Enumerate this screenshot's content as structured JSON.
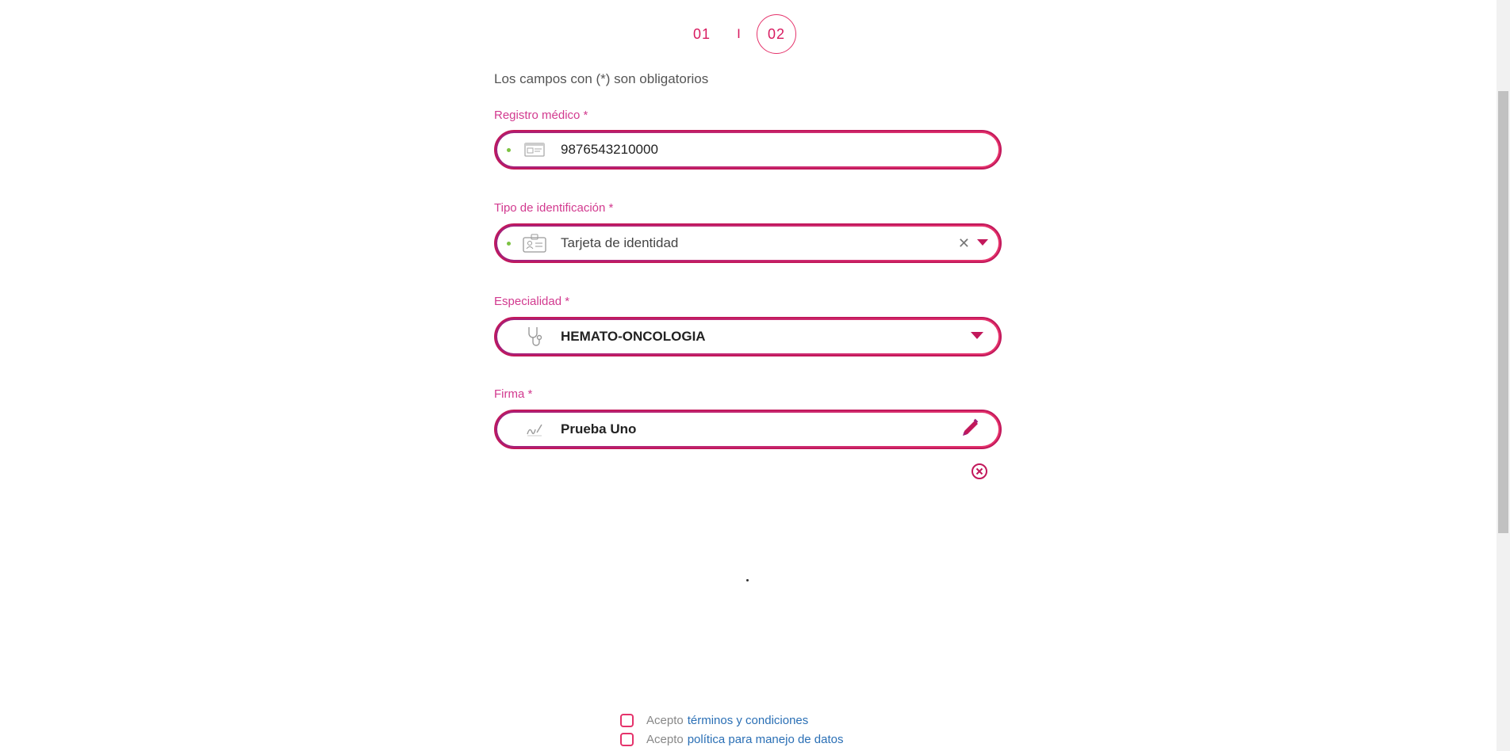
{
  "stepper": {
    "step1": "01",
    "separator": "I",
    "step2": "02"
  },
  "form": {
    "required_note": "Los campos con (*) son obligatorios",
    "registro": {
      "label": "Registro médico *",
      "value": "9876543210000",
      "icon": "id-card-icon"
    },
    "tipo_id": {
      "label": "Tipo de identificación *",
      "value": "Tarjeta de identidad",
      "icon": "badge-icon"
    },
    "especialidad": {
      "label": "Especialidad *",
      "value": "HEMATO-ONCOLOGIA",
      "icon": "stethoscope-icon"
    },
    "firma": {
      "label": "Firma *",
      "value": "Prueba Uno",
      "icon": "signature-icon"
    }
  },
  "consents": [
    {
      "prefix": "Acepto",
      "link": "términos y condiciones"
    },
    {
      "prefix": "Acepto",
      "link": "política para manejo de datos"
    }
  ],
  "colors": {
    "accent": "#e5336b",
    "accent_dark": "#a3207a",
    "valid": "#7cc242",
    "link": "#2a6fb5"
  }
}
